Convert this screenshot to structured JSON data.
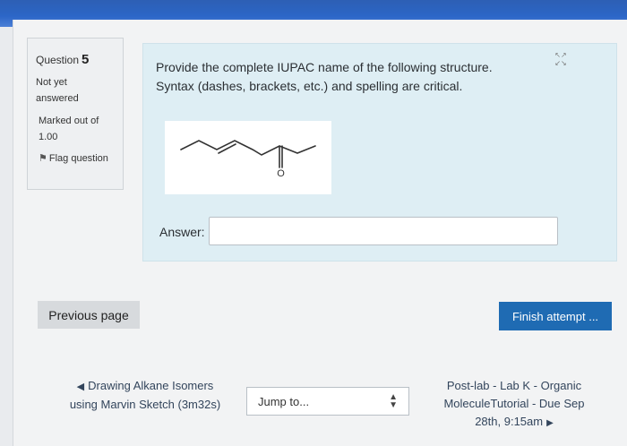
{
  "question_info": {
    "label": "Question",
    "number": "5",
    "status": "Not yet answered",
    "marks": "Marked out of 1.00",
    "flag_label": "Flag question"
  },
  "question": {
    "text": "Provide the complete IUPAC name of the following structure. Syntax (dashes, brackets, etc.) and spelling are critical.",
    "structure_atom_label": "O",
    "answer_label": "Answer:",
    "answer_value": ""
  },
  "navigation": {
    "previous_page": "Previous page",
    "finish_attempt": "Finish attempt ...",
    "prev_activity": "Drawing Alkane Isomers using Marvin Sketch (3m32s)",
    "jump_to": "Jump to...",
    "next_activity": "Post-lab - Lab K - Organic MoleculeTutorial - Due Sep 28th, 9:15am"
  },
  "icons": {
    "flag": "flag-icon",
    "expand": "expand-icon",
    "prev": "triangle-left-icon",
    "next": "triangle-right-icon",
    "select": "select-arrows-icon"
  },
  "colors": {
    "top_bar": "#2c66c7",
    "question_bg": "#deeef4",
    "finish_button": "#1f6bb3"
  }
}
